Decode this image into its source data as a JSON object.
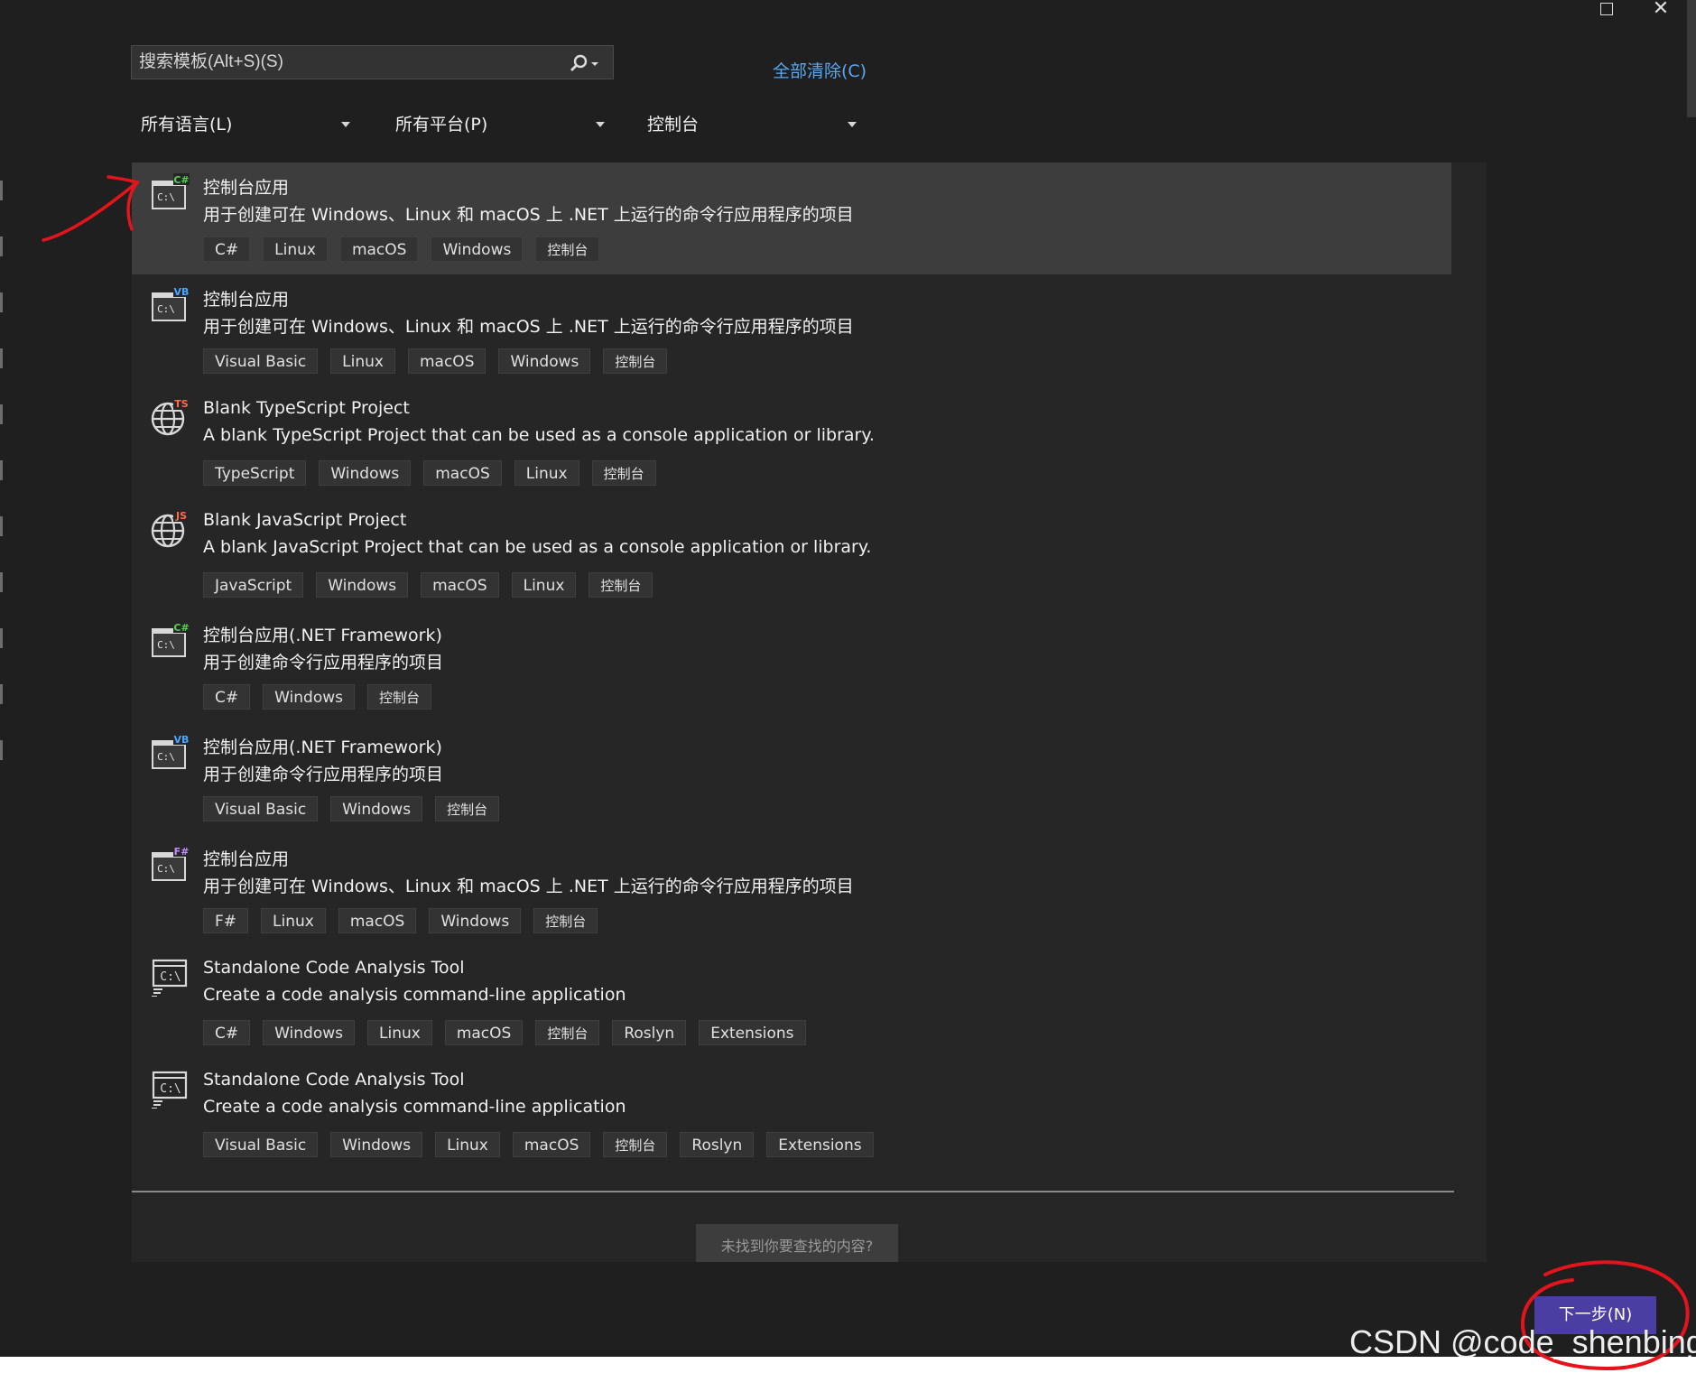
{
  "search": {
    "placeholder": "搜索模板(Alt+S)(S)"
  },
  "clear_all_label": "全部清除(C)",
  "filters": {
    "language": "所有语言(L)",
    "platform": "所有平台(P)",
    "project_type": "控制台"
  },
  "templates": [
    {
      "icon": "console-csharp-icon",
      "badge": "C#",
      "badge_color": "#54d354",
      "title": "控制台应用",
      "description": "用于创建可在 Windows、Linux 和 macOS 上 .NET 上运行的命令行应用程序的项目",
      "tags": [
        "C#",
        "Linux",
        "macOS",
        "Windows",
        "控制台"
      ],
      "selected": true
    },
    {
      "icon": "console-vb-icon",
      "badge": "VB",
      "badge_color": "#4aa6ff",
      "title": "控制台应用",
      "description": "用于创建可在 Windows、Linux 和 macOS 上 .NET 上运行的命令行应用程序的项目",
      "tags": [
        "Visual Basic",
        "Linux",
        "macOS",
        "Windows",
        "控制台"
      ],
      "selected": false
    },
    {
      "icon": "globe-typescript-icon",
      "badge": "TS",
      "badge_color": "#ff6a4a",
      "title": "Blank TypeScript Project",
      "description": "A blank TypeScript Project that can be used as a console application or library.",
      "tags": [
        "TypeScript",
        "Windows",
        "macOS",
        "Linux",
        "控制台"
      ],
      "selected": false
    },
    {
      "icon": "globe-javascript-icon",
      "badge": "JS",
      "badge_color": "#ff6a4a",
      "title": "Blank JavaScript Project",
      "description": "A blank JavaScript Project that can be used as a console application or library.",
      "tags": [
        "JavaScript",
        "Windows",
        "macOS",
        "Linux",
        "控制台"
      ],
      "selected": false
    },
    {
      "icon": "console-csharp-icon",
      "badge": "C#",
      "badge_color": "#54d354",
      "title": "控制台应用(.NET Framework)",
      "description": "用于创建命令行应用程序的项目",
      "tags": [
        "C#",
        "Windows",
        "控制台"
      ],
      "selected": false
    },
    {
      "icon": "console-vb-icon",
      "badge": "VB",
      "badge_color": "#4aa6ff",
      "title": "控制台应用(.NET Framework)",
      "description": "用于创建命令行应用程序的项目",
      "tags": [
        "Visual Basic",
        "Windows",
        "控制台"
      ],
      "selected": false
    },
    {
      "icon": "console-fsharp-icon",
      "badge": "F#",
      "badge_color": "#c58cff",
      "title": "控制台应用",
      "description": "用于创建可在 Windows、Linux 和 macOS 上 .NET 上运行的命令行应用程序的项目",
      "tags": [
        "F#",
        "Linux",
        "macOS",
        "Windows",
        "控制台"
      ],
      "selected": false
    },
    {
      "icon": "code-analysis-icon",
      "badge": "",
      "badge_color": "",
      "title": "Standalone Code Analysis Tool",
      "description": "Create a code analysis command-line application",
      "tags": [
        "C#",
        "Windows",
        "Linux",
        "macOS",
        "控制台",
        "Roslyn",
        "Extensions"
      ],
      "selected": false
    },
    {
      "icon": "code-analysis-icon",
      "badge": "",
      "badge_color": "",
      "title": "Standalone Code Analysis Tool",
      "description": "Create a code analysis command-line application",
      "tags": [
        "Visual Basic",
        "Windows",
        "Linux",
        "macOS",
        "控制台",
        "Roslyn",
        "Extensions"
      ],
      "selected": false
    }
  ],
  "not_found_label": "未找到你要查找的内容?",
  "next_button_label": "下一步(N)",
  "watermark": "CSDN @code_shenbing",
  "colors": {
    "accent": "#4b3ea3",
    "link": "#5aa7f0",
    "annotation": "#e3141c",
    "selected_row": "#3d3d3d"
  }
}
